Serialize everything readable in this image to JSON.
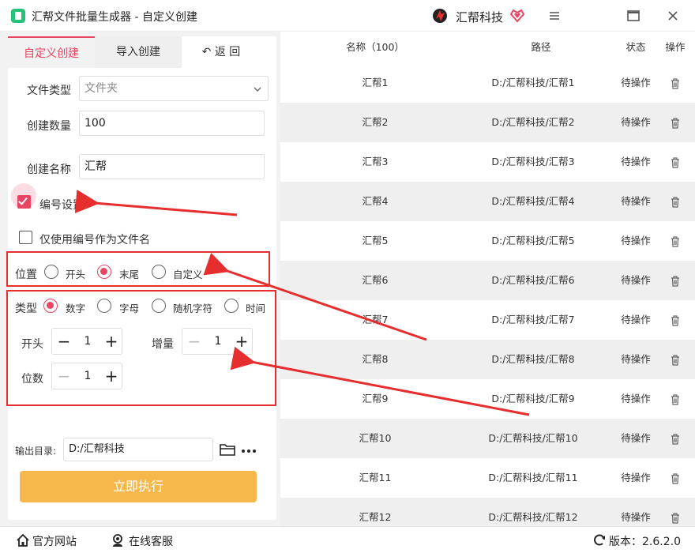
{
  "window": {
    "title": "汇帮文件批量生成器 - 自定义创建",
    "brand": "汇帮科技"
  },
  "tabs": {
    "custom": "自定义创建",
    "import": "导入创建",
    "back": "↶ 返  回"
  },
  "form": {
    "file_type_label": "文件类型",
    "file_type_value": "文件夹",
    "count_label": "创建数量",
    "count_value": "100",
    "name_label": "创建名称",
    "name_value": "汇帮",
    "numbering_label": "编号设置",
    "numbering_checked": true,
    "only_number_label": "仅使用编号作为文件名",
    "only_number_checked": false,
    "position_label": "位置",
    "position_options": [
      "开头",
      "末尾",
      "自定义"
    ],
    "position_selected": "末尾",
    "type_label": "类型",
    "type_options": [
      "数字",
      "字母",
      "随机字符",
      "时间"
    ],
    "type_selected": "数字",
    "start_label": "开头",
    "start_value": "1",
    "increment_label": "增量",
    "increment_value": "1",
    "digits_label": "位数",
    "digits_value": "1",
    "output_label": "输出目录:",
    "output_value": "D:/汇帮科技",
    "run_label": "立即执行"
  },
  "table": {
    "headers": {
      "name": "名称（100）",
      "path": "路径",
      "status": "状态",
      "op": "操作"
    },
    "rows": [
      {
        "name": "汇帮1",
        "path": "D:/汇帮科技/汇帮1",
        "status": "待操作"
      },
      {
        "name": "汇帮2",
        "path": "D:/汇帮科技/汇帮2",
        "status": "待操作"
      },
      {
        "name": "汇帮3",
        "path": "D:/汇帮科技/汇帮3",
        "status": "待操作"
      },
      {
        "name": "汇帮4",
        "path": "D:/汇帮科技/汇帮4",
        "status": "待操作"
      },
      {
        "name": "汇帮5",
        "path": "D:/汇帮科技/汇帮5",
        "status": "待操作"
      },
      {
        "name": "汇帮6",
        "path": "D:/汇帮科技/汇帮6",
        "status": "待操作"
      },
      {
        "name": "汇帮7",
        "path": "D:/汇帮科技/汇帮7",
        "status": "待操作"
      },
      {
        "name": "汇帮8",
        "path": "D:/汇帮科技/汇帮8",
        "status": "待操作"
      },
      {
        "name": "汇帮9",
        "path": "D:/汇帮科技/汇帮9",
        "status": "待操作"
      },
      {
        "name": "汇帮10",
        "path": "D:/汇帮科技/汇帮10",
        "status": "待操作"
      },
      {
        "name": "汇帮11",
        "path": "D:/汇帮科技/汇帮11",
        "status": "待操作"
      },
      {
        "name": "汇帮12",
        "path": "D:/汇帮科技/汇帮12",
        "status": "待操作"
      }
    ]
  },
  "footer": {
    "website": "官方网站",
    "support": "在线客服",
    "version": "版本：2.6.2.0"
  },
  "colors": {
    "accent": "#e84463",
    "run_button": "#f7b84b",
    "annotation": "#e62e2e",
    "row_alt": "#efefef"
  },
  "icons": [
    "app-logo-icon",
    "brand-logo-icon",
    "heart-icon",
    "menu-icon",
    "maximize-icon",
    "close-icon",
    "chevron-down-icon",
    "folder-icon",
    "more-icon",
    "trash-icon",
    "home-icon",
    "support-icon",
    "refresh-icon"
  ]
}
